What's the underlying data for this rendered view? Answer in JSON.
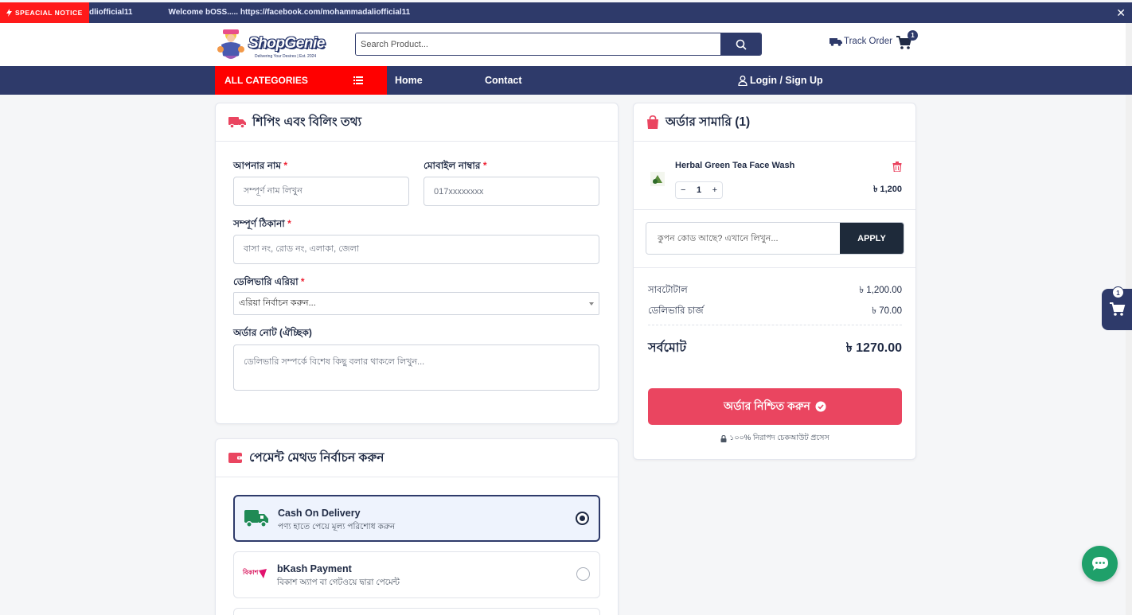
{
  "notice": {
    "badge": "SPEACIAL NOTICE",
    "text_start": "dliofficial11",
    "text_main": "Welcome bOSS..... https://facebook.com/mohammadaliofficial11",
    "close": "✕"
  },
  "header": {
    "logo_name": "ShopGenie",
    "logo_tagline": "Delivering Your Desires | Est. 2024",
    "search_placeholder": "Search Product...",
    "track_label": "Track Order",
    "cart_count": "1"
  },
  "nav": {
    "all_categories": "ALL CATEGORIES",
    "home": "Home",
    "contact": "Contact",
    "login": "Login / Sign Up"
  },
  "shipping": {
    "title": "শিপিং এবং বিলিং তথ্য",
    "name_label": "আপনার নাম",
    "name_placeholder": "সম্পূর্ণ নাম লিখুন",
    "mobile_label": "মোবাইল নাম্বার",
    "mobile_placeholder": "017xxxxxxxx",
    "address_label": "সম্পূর্ণ ঠিকানা",
    "address_placeholder": "বাসা নং, রোড নং, এলাকা, জেলা",
    "area_label": "ডেলিভারি এরিয়া",
    "area_value": "এরিয়া নির্বাচন করুন...",
    "note_label": "অর্ডার নোট (ঐচ্ছিক)",
    "note_placeholder": "ডেলিভারি সম্পর্কে বিশেষ কিছু বলার থাকলে লিখুন...",
    "required_mark": "*"
  },
  "payment": {
    "title": "পেমেন্ট মেথড নির্বাচন করুন",
    "options": [
      {
        "title": "Cash On Delivery",
        "subtitle": "পণ্য হাতে পেয়ে মূল্য পরিশোধ করুন",
        "selected": true
      },
      {
        "title": "bKash Payment",
        "subtitle": "বিকাশ অ্যাপ বা গেটওয়ে দ্বারা পেমেন্ট",
        "selected": false
      }
    ],
    "bkash_logo_text": "বিকাশ"
  },
  "summary": {
    "title": "অর্ডার সামারি (1)",
    "item_name": "Herbal Green Tea Face Wash",
    "item_price": "৳ 1,200",
    "qty_minus": "−",
    "qty_value": "1",
    "qty_plus": "+",
    "coupon_placeholder": "কুপন কোড আছে? এখানে লিখুন...",
    "apply_label": "APPLY",
    "subtotal_label": "সাবটোটাল",
    "subtotal_value": "৳ 1,200.00",
    "delivery_label": "ডেলিভারি চার্জ",
    "delivery_value": "৳ 70.00",
    "total_label": "সর্বমোট",
    "total_value": "৳ 1270.00",
    "confirm_label": "অর্ডার নিশ্চিত করুন",
    "secure_text": "১০০% নিরাপদ চেকআউট প্রসেস"
  },
  "side_cart_count": "1",
  "colors": {
    "navy": "#2e3a6a",
    "red": "#ff0000",
    "confirm": "#ea4560",
    "chat": "#1fa06a"
  }
}
